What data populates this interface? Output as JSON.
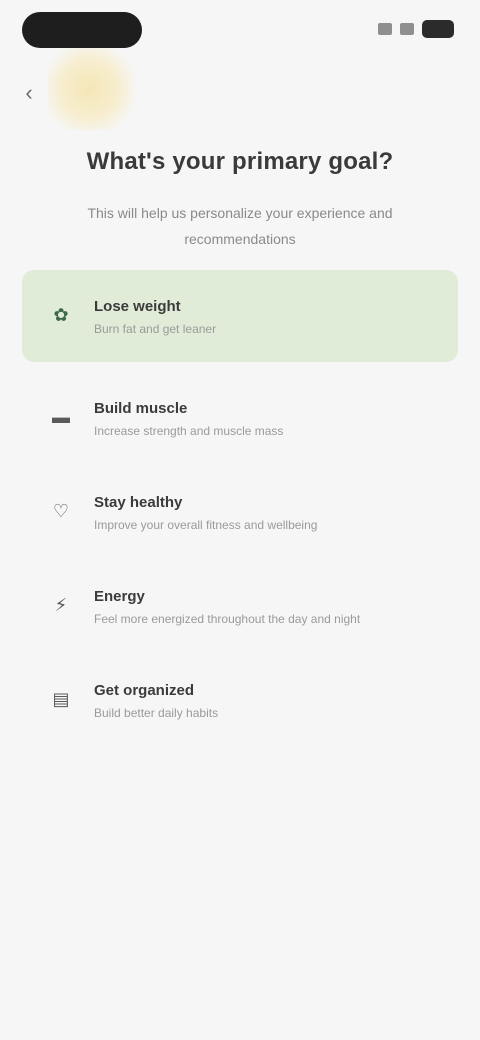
{
  "status_bar": {
    "pill_label": "",
    "icons": [
      "signal-icon",
      "wifi-icon",
      "battery-icon"
    ]
  },
  "header": {
    "back_icon": "chevron-left-icon",
    "title": "What's your primary goal?",
    "subtitle": "This will help us personalize your experience and recommendations"
  },
  "options": [
    {
      "icon": "sprout-icon",
      "title": "Lose weight",
      "description": "Burn fat and get leaner",
      "selected": true
    },
    {
      "icon": "dumbbell-icon",
      "title": "Build muscle",
      "description": "Increase strength and muscle mass",
      "selected": false
    },
    {
      "icon": "heart-icon",
      "title": "Stay healthy",
      "description": "Improve your overall fitness and wellbeing",
      "selected": false
    },
    {
      "icon": "bolt-icon",
      "title": "Energy",
      "description": "Feel more energized throughout the day and night",
      "selected": false
    },
    {
      "icon": "clipboard-icon",
      "title": "Get organized",
      "description": "Build better daily habits",
      "selected": false
    }
  ],
  "colors": {
    "background": "#f6f6f6",
    "selected_option": "#e0ecd7",
    "title_text": "#3a3a3a",
    "muted_text": "#8a8a8a"
  }
}
